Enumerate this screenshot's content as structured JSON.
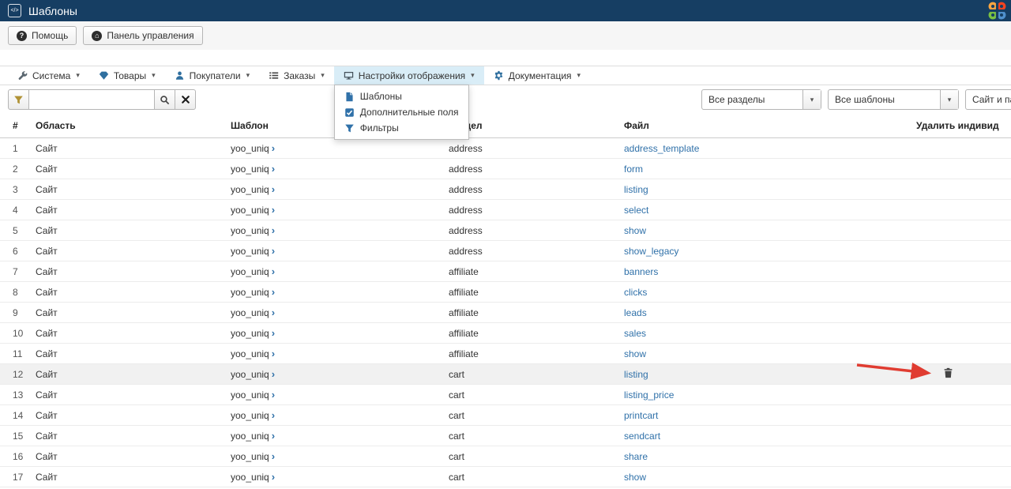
{
  "header": {
    "title": "Шаблоны"
  },
  "toolbar": {
    "help_label": "Помощь",
    "panel_label": "Панель управления"
  },
  "menu": {
    "items": [
      {
        "id": "system",
        "label": "Система",
        "icon": "wrench-icon",
        "icon_color": "#5b6770"
      },
      {
        "id": "products",
        "label": "Товары",
        "icon": "gem-icon",
        "icon_color": "#2f6f9f"
      },
      {
        "id": "customers",
        "label": "Покупатели",
        "icon": "user-icon",
        "icon_color": "#2f6f9f"
      },
      {
        "id": "orders",
        "label": "Заказы",
        "icon": "list-icon",
        "icon_color": "#444444"
      },
      {
        "id": "display-settings",
        "label": "Настройки отображения",
        "icon": "display-icon",
        "icon_color": "#44505a",
        "active": true
      },
      {
        "id": "documentation",
        "label": "Документация",
        "icon": "gear-icon",
        "icon_color": "#2f6f9f"
      }
    ],
    "dropdown": {
      "items": [
        {
          "id": "templates",
          "label": "Шаблоны",
          "icon": "file-icon"
        },
        {
          "id": "extra-fields",
          "label": "Дополнительные поля",
          "icon": "checkbox-icon"
        },
        {
          "id": "filters",
          "label": "Фильтры",
          "icon": "filter-icon"
        }
      ]
    }
  },
  "search": {
    "value": "",
    "placeholder": ""
  },
  "filters": {
    "selects": [
      {
        "id": "all-sections",
        "value": "Все разделы"
      },
      {
        "id": "all-templates",
        "value": "Все шаблоны"
      },
      {
        "id": "site-and-panel",
        "value": "Сайт и панель"
      }
    ]
  },
  "table": {
    "headers": [
      "#",
      "Область",
      "Шаблон",
      "Раздел",
      "Файл",
      "Удалить индивид"
    ],
    "rows": [
      {
        "num": "1",
        "area": "Сайт",
        "template": "yoo_uniq",
        "section": "address",
        "file": "address_template"
      },
      {
        "num": "2",
        "area": "Сайт",
        "template": "yoo_uniq",
        "section": "address",
        "file": "form"
      },
      {
        "num": "3",
        "area": "Сайт",
        "template": "yoo_uniq",
        "section": "address",
        "file": "listing"
      },
      {
        "num": "4",
        "area": "Сайт",
        "template": "yoo_uniq",
        "section": "address",
        "file": "select"
      },
      {
        "num": "5",
        "area": "Сайт",
        "template": "yoo_uniq",
        "section": "address",
        "file": "show"
      },
      {
        "num": "6",
        "area": "Сайт",
        "template": "yoo_uniq",
        "section": "address",
        "file": "show_legacy"
      },
      {
        "num": "7",
        "area": "Сайт",
        "template": "yoo_uniq",
        "section": "affiliate",
        "file": "banners"
      },
      {
        "num": "8",
        "area": "Сайт",
        "template": "yoo_uniq",
        "section": "affiliate",
        "file": "clicks"
      },
      {
        "num": "9",
        "area": "Сайт",
        "template": "yoo_uniq",
        "section": "affiliate",
        "file": "leads"
      },
      {
        "num": "10",
        "area": "Сайт",
        "template": "yoo_uniq",
        "section": "affiliate",
        "file": "sales"
      },
      {
        "num": "11",
        "area": "Сайт",
        "template": "yoo_uniq",
        "section": "affiliate",
        "file": "show"
      },
      {
        "num": "12",
        "area": "Сайт",
        "template": "yoo_uniq",
        "section": "cart",
        "file": "listing",
        "trash": true,
        "highlight": true
      },
      {
        "num": "13",
        "area": "Сайт",
        "template": "yoo_uniq",
        "section": "cart",
        "file": "listing_price"
      },
      {
        "num": "14",
        "area": "Сайт",
        "template": "yoo_uniq",
        "section": "cart",
        "file": "printcart"
      },
      {
        "num": "15",
        "area": "Сайт",
        "template": "yoo_uniq",
        "section": "cart",
        "file": "sendcart"
      },
      {
        "num": "16",
        "area": "Сайт",
        "template": "yoo_uniq",
        "section": "cart",
        "file": "share"
      },
      {
        "num": "17",
        "area": "Сайт",
        "template": "yoo_uniq",
        "section": "cart",
        "file": "show"
      }
    ]
  },
  "colors": {
    "topbar": "#163e63",
    "link": "#3071a9",
    "active_menu_bg": "#d9edf7",
    "arrow": "#e03c31"
  }
}
